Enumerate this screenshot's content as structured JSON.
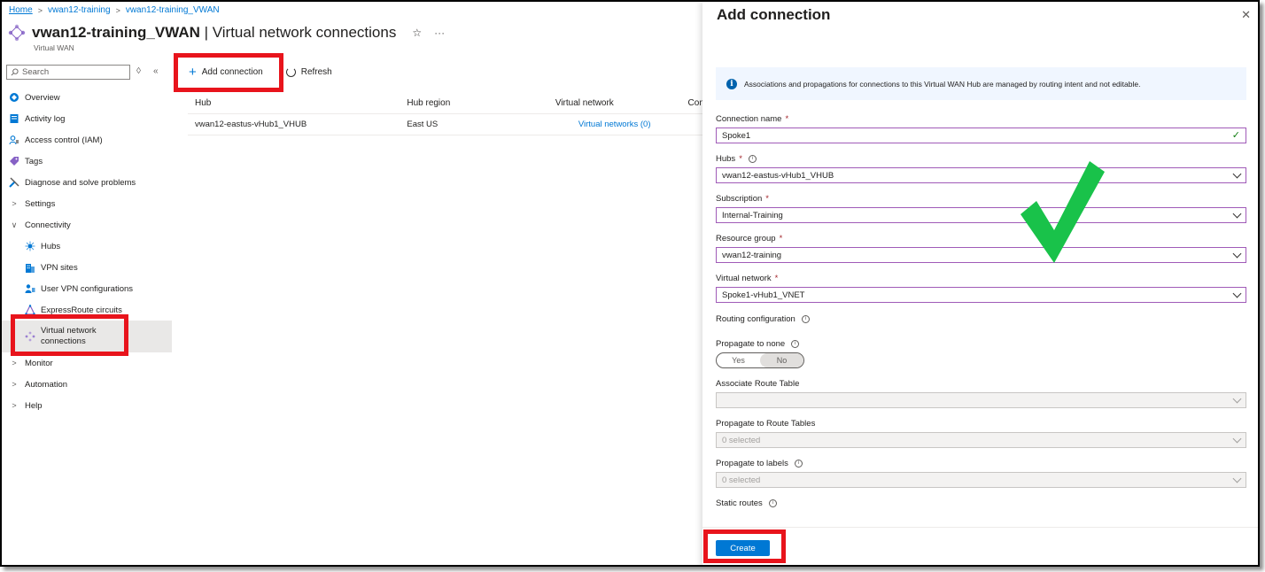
{
  "breadcrumb": [
    "Home",
    "vwan12-training",
    "vwan12-training_VWAN"
  ],
  "header": {
    "resource_name": "vwan12-training_VWAN",
    "page_name": " | Virtual network connections",
    "resource_type": "Virtual WAN",
    "favorite_icon": "star-icon",
    "more_icon": "ellipsis-icon"
  },
  "search": {
    "placeholder": "Search"
  },
  "sidebar": {
    "items": [
      {
        "label": "Overview",
        "icon": "overview-icon"
      },
      {
        "label": "Activity log",
        "icon": "activity-log-icon"
      },
      {
        "label": "Access control (IAM)",
        "icon": "iam-icon"
      },
      {
        "label": "Tags",
        "icon": "tag-icon"
      },
      {
        "label": "Diagnose and solve problems",
        "icon": "wrench-icon"
      },
      {
        "label": "Settings",
        "icon": "chevron-right-icon"
      },
      {
        "label": "Connectivity",
        "icon": "chevron-down-icon"
      },
      {
        "label": "Hubs",
        "icon": "hub-icon"
      },
      {
        "label": "VPN sites",
        "icon": "building-icon"
      },
      {
        "label": "User VPN configurations",
        "icon": "users-icon"
      },
      {
        "label": "ExpressRoute circuits",
        "icon": "expressroute-icon"
      },
      {
        "label": "Virtual network connections",
        "icon": "vwan-icon"
      },
      {
        "label": "Monitor",
        "icon": "chevron-right-icon"
      },
      {
        "label": "Automation",
        "icon": "chevron-right-icon"
      },
      {
        "label": "Help",
        "icon": "chevron-right-icon"
      }
    ]
  },
  "toolbar": {
    "add_label": "Add connection",
    "refresh_label": "Refresh"
  },
  "table": {
    "columns": [
      "Hub",
      "Hub region",
      "Virtual network",
      "Con"
    ],
    "rows": [
      {
        "hub": "vwan12-eastus-vHub1_VHUB",
        "region": "East US",
        "vnet": "Virtual networks (0)"
      }
    ]
  },
  "panel": {
    "title": "Add connection",
    "info": "Associations and propagations for connections to this Virtual WAN Hub are managed by routing intent and not editable.",
    "fields": {
      "connection_name": {
        "label": "Connection name",
        "value": "Spoke1"
      },
      "hubs": {
        "label": "Hubs",
        "value": "vwan12-eastus-vHub1_VHUB"
      },
      "subscription": {
        "label": "Subscription",
        "value": "Internal-Training"
      },
      "resource_group": {
        "label": "Resource group",
        "value": "vwan12-training"
      },
      "virtual_network": {
        "label": "Virtual network",
        "value": "Spoke1-vHub1_VNET"
      }
    },
    "routing_label": "Routing configuration",
    "propagate_none_label": "Propagate to none",
    "toggle": {
      "yes": "Yes",
      "no": "No",
      "selected": "No"
    },
    "associate_label": "Associate Route Table",
    "propagate_tables_label": "Propagate to Route Tables",
    "propagate_tables_value": "0 selected",
    "propagate_labels_label": "Propagate to labels",
    "propagate_labels_value": "0 selected",
    "static_routes_label": "Static routes",
    "create_label": "Create"
  },
  "colors": {
    "accent": "#0078d4",
    "highlight": "#e8141c",
    "check": "#19c24a"
  }
}
